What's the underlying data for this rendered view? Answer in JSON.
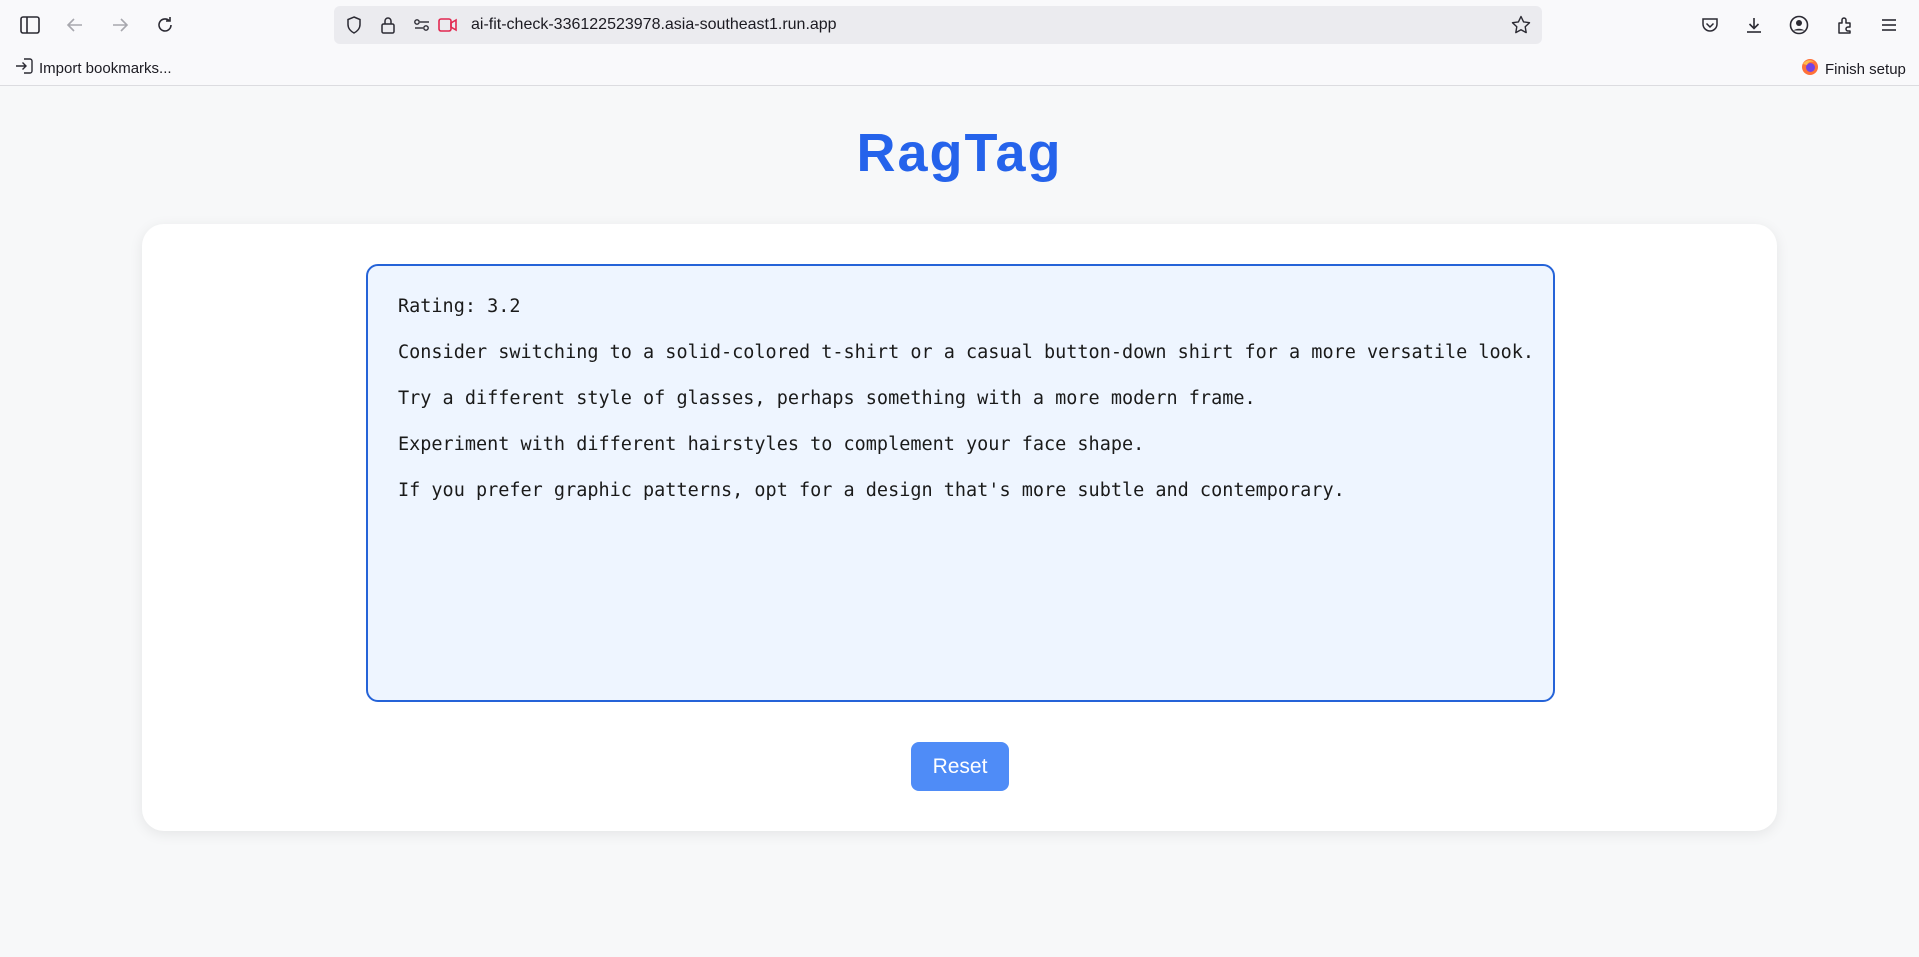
{
  "browser": {
    "url": "ai-fit-check-336122523978.asia-southeast1.run.app",
    "bookmarks": {
      "import_label": "Import bookmarks...",
      "finish_setup_label": "Finish setup"
    }
  },
  "app": {
    "title": "RagTag",
    "result_lines": [
      "Rating: 3.2",
      "Consider switching to a solid-colored t-shirt or a casual button-down shirt for a more versatile look.",
      "Try a different style of glasses, perhaps something with a more modern frame.",
      "Experiment with different hairstyles to complement your face shape.",
      "If you prefer graphic patterns, opt for a design that's more subtle and contemporary."
    ],
    "reset_label": "Reset"
  },
  "colors": {
    "accent": "#2563eb",
    "button": "#4f8cf7",
    "result_bg": "#eef5ff",
    "result_border": "#2563d8"
  }
}
